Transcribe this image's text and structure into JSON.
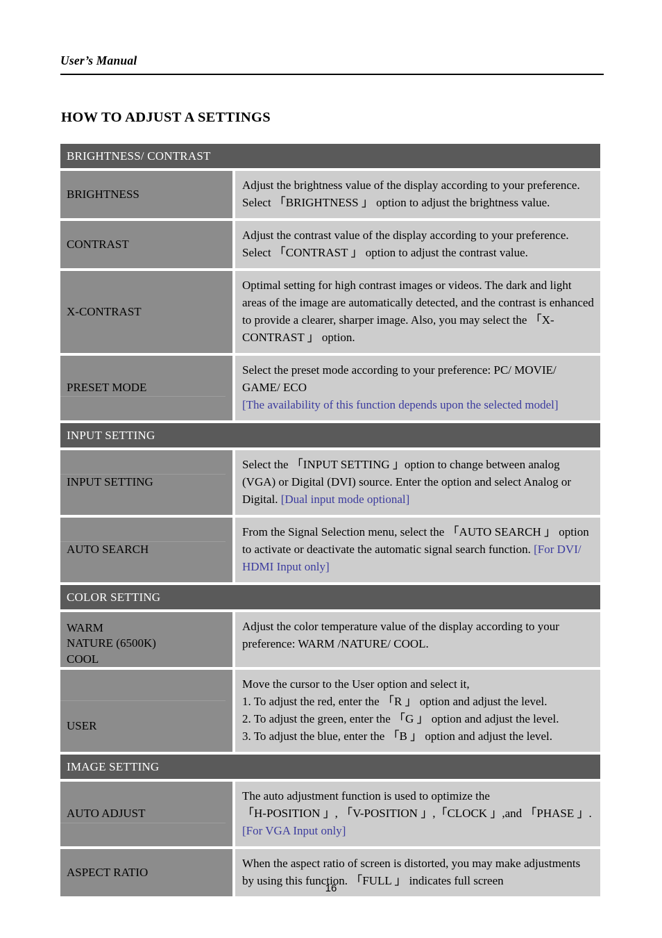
{
  "document": {
    "running_header": "User’s Manual",
    "page_title": "HOW TO ADJUST A SETTINGS",
    "page_number": "16"
  },
  "colors": {
    "section_band": "#5a5a5a",
    "label_cell": "#8c8c8c",
    "description_cell": "#cdcdcd",
    "note_text": "#3b3b9e",
    "page_background": "#ffffff"
  },
  "table": {
    "sections": [
      {
        "heading": "BRIGHTNESS/ CONTRAST",
        "rows": [
          {
            "label_lines": [
              "BRIGHTNESS"
            ],
            "description_lines": [
              "Adjust the brightness value of the display according to your preference. Select 「BRIGHTNESS 」 option to adjust the brightness value."
            ],
            "note": ""
          },
          {
            "label_lines": [
              "CONTRAST"
            ],
            "description_lines": [
              "Adjust the contrast value of the display according to your preference. Select 「CONTRAST 」 option to adjust the contrast value."
            ],
            "note": ""
          },
          {
            "label_lines": [
              "X-CONTRAST"
            ],
            "description_lines": [
              "Optimal setting for high contrast images or videos. The dark and light areas of the image are automatically detected, and the contrast is enhanced to provide a clearer, sharper image. Also, you may select the 「X-CONTRAST 」 option."
            ],
            "note": ""
          },
          {
            "label_lines": [
              "PRESET MODE"
            ],
            "description_lines": [
              "Select the preset mode according to your preference: PC/ MOVIE/ GAME/ ECO"
            ],
            "note": "[The availability of this function depends upon the selected model]"
          }
        ]
      },
      {
        "heading": "INPUT SETTING",
        "rows": [
          {
            "label_lines": [
              "INPUT SETTING"
            ],
            "description_lines": [
              "Select the 「INPUT SETTING 」option to change between analog (VGA) or Digital (DVI) source. Enter the option and select Analog or Digital."
            ],
            "note": "[Dual input mode optional]",
            "note_inline": true
          },
          {
            "label_lines": [
              "AUTO SEARCH"
            ],
            "description_lines": [
              "From the Signal Selection menu, select the  「AUTO SEARCH 」 option to activate or deactivate the automatic signal search function."
            ],
            "note": "[For DVI/ HDMI Input only]",
            "note_inline": true
          }
        ]
      },
      {
        "heading": "COLOR SETTING",
        "rows": [
          {
            "label_lines": [
              "WARM",
              "NATURE (6500K)",
              "COOL"
            ],
            "description_lines": [
              "Adjust the color temperature value of the display according to your preference: WARM /NATURE/ COOL."
            ],
            "note": ""
          },
          {
            "label_lines": [
              "USER"
            ],
            "description_lines": [
              "Move the cursor to the User option and select it,",
              "1. To adjust the red, enter the 「R 」 option and adjust the level.",
              "2. To adjust the green, enter the 「G 」 option and adjust the level.",
              "3. To adjust the blue, enter the 「B 」 option and adjust the level."
            ],
            "note": ""
          }
        ]
      },
      {
        "heading": "IMAGE SETTING",
        "rows": [
          {
            "label_lines": [
              "AUTO ADJUST"
            ],
            "description_lines": [
              "The auto adjustment function is used to optimize the",
              "「H-POSITION 」, 「V-POSITION 」,「CLOCK 」,and 「PHASE 」."
            ],
            "note": "[For VGA Input only]"
          },
          {
            "label_lines": [
              "ASPECT RATIO"
            ],
            "description_lines": [
              "When the aspect ratio of screen is distorted, you may make adjustments by using this function. 「FULL 」 indicates full screen"
            ],
            "note": ""
          }
        ]
      }
    ]
  }
}
